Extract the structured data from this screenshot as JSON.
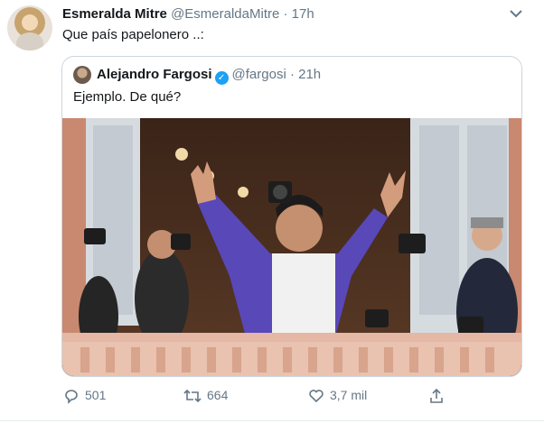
{
  "tweet": {
    "author_name": "Esmeralda Mitre",
    "author_handle": "@EsmeraldaMitre",
    "separator": "·",
    "time": "17h",
    "text": "Que país papelonero ..:"
  },
  "quoted": {
    "author_name": "Alejandro Fargosi",
    "author_handle": "@fargosi",
    "separator": "·",
    "time": "21h",
    "text": "Ejemplo. De qué?"
  },
  "actions": {
    "replies": "501",
    "retweets": "664",
    "likes": "3,7 mil"
  },
  "icons": {
    "caret": "chevron-down-icon",
    "verified": "verified-badge-icon",
    "reply": "reply-icon",
    "retweet": "retweet-icon",
    "like": "heart-icon",
    "share": "share-icon"
  },
  "colors": {
    "text": "#14171a",
    "muted": "#657786",
    "border": "#ccd6dd",
    "verified": "#1da1f2"
  }
}
